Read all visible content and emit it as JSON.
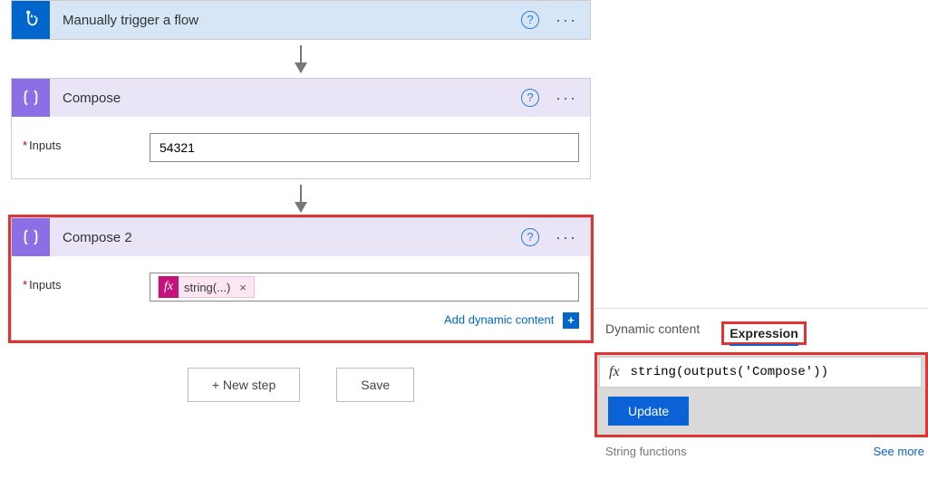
{
  "trigger": {
    "title": "Manually trigger a flow"
  },
  "compose1": {
    "title": "Compose",
    "inputs_label": "Inputs",
    "inputs_value": "54321"
  },
  "compose2": {
    "title": "Compose 2",
    "inputs_label": "Inputs",
    "chip_label": "string(...)",
    "add_dynamic": "Add dynamic content"
  },
  "footer": {
    "new_step": "+ New step",
    "save": "Save"
  },
  "panel": {
    "tab_dynamic": "Dynamic content",
    "tab_expression": "Expression",
    "expression_value": "string(outputs('Compose'))",
    "update": "Update",
    "section_label": "String functions",
    "see_more": "See more"
  },
  "glyphs": {
    "help": "?",
    "more": "···",
    "fx": "fx",
    "close": "×",
    "plus": "+"
  }
}
